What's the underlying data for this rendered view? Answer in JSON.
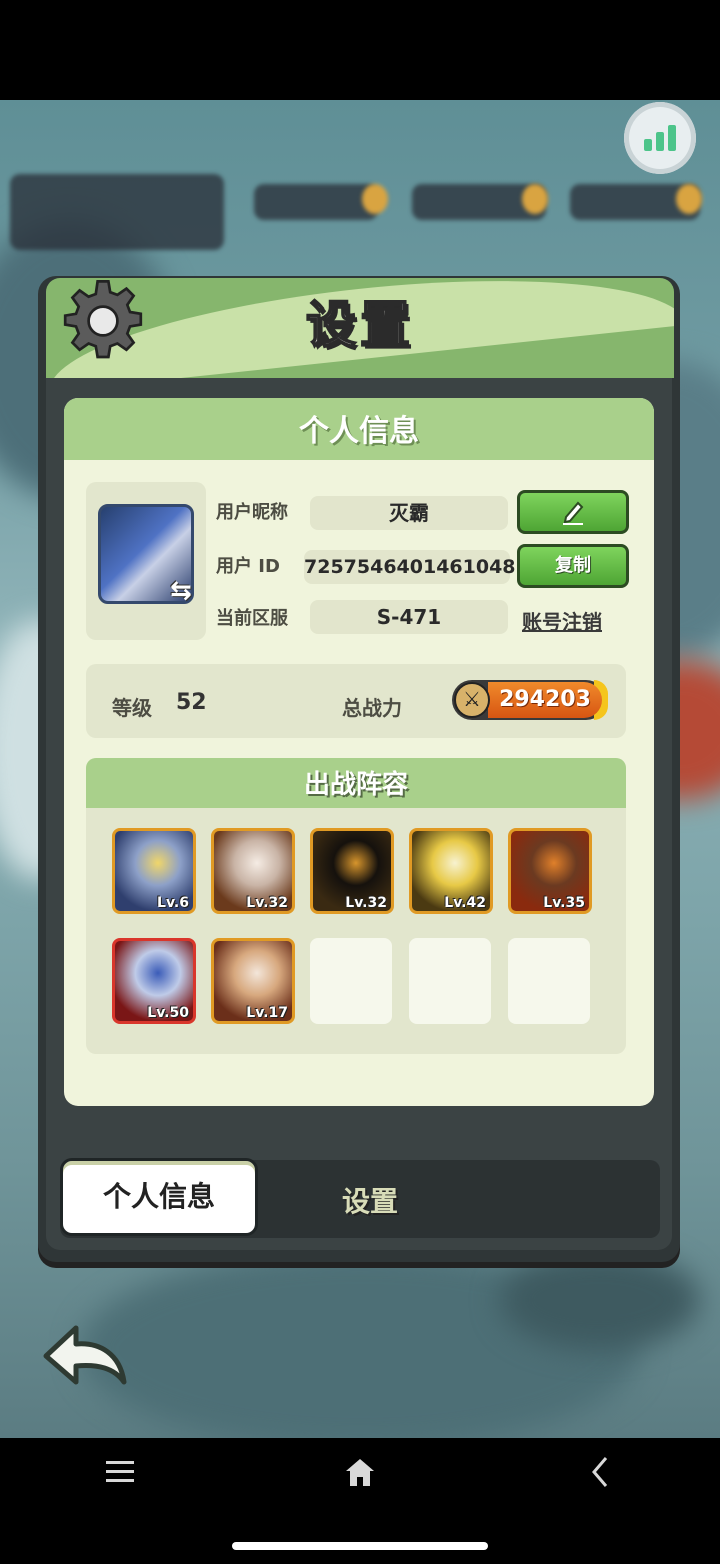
{
  "panel": {
    "title": "设置",
    "card_title": "个人信息"
  },
  "profile": {
    "nickname_label": "用户昵称",
    "nickname": "灭霸",
    "id_label": "用户 ID",
    "user_id": "7257546401461048",
    "server_label": "当前区服",
    "server": "S-471",
    "copy_label": "复制",
    "cancel_account_label": "账号注销"
  },
  "stats": {
    "level_label": "等级",
    "level": "52",
    "power_label": "总战力",
    "power": "294203"
  },
  "lineup": {
    "title": "出战阵容",
    "heroes": [
      {
        "level": "Lv.6",
        "colors": [
          "#2f3f6e",
          "#f0d66a",
          "#8da0c8"
        ]
      },
      {
        "level": "Lv.32",
        "colors": [
          "#6b3a1c",
          "#f5ece4",
          "#c9b4a6"
        ]
      },
      {
        "level": "Lv.32",
        "colors": [
          "#3a2a12",
          "#d7952c",
          "#15110d"
        ]
      },
      {
        "level": "Lv.42",
        "colors": [
          "#4b3a12",
          "#f7f2d0",
          "#e7c946"
        ]
      },
      {
        "level": "Lv.35",
        "colors": [
          "#8a2a0e",
          "#e0802a",
          "#6b3a21"
        ]
      },
      {
        "level": "Lv.50",
        "colors": [
          "#7a1616",
          "#3b5cb8",
          "#bfcbe8"
        ]
      },
      {
        "level": "Lv.17",
        "colors": [
          "#6b2f1a",
          "#f3e6da",
          "#d7a87e"
        ]
      }
    ]
  },
  "tabs": {
    "profile": "个人信息",
    "settings": "设置"
  },
  "colors": {
    "header_green": "#86b66d",
    "card_bg": "#f0f4dc",
    "button_green": "#4ea534",
    "power_orange": "#d75512"
  },
  "icons": [
    "gear-icon",
    "signal-icon",
    "edit-icon",
    "swap-icon",
    "sword-icon",
    "back-arrow-icon",
    "menu-icon",
    "home-icon",
    "back-icon"
  ]
}
